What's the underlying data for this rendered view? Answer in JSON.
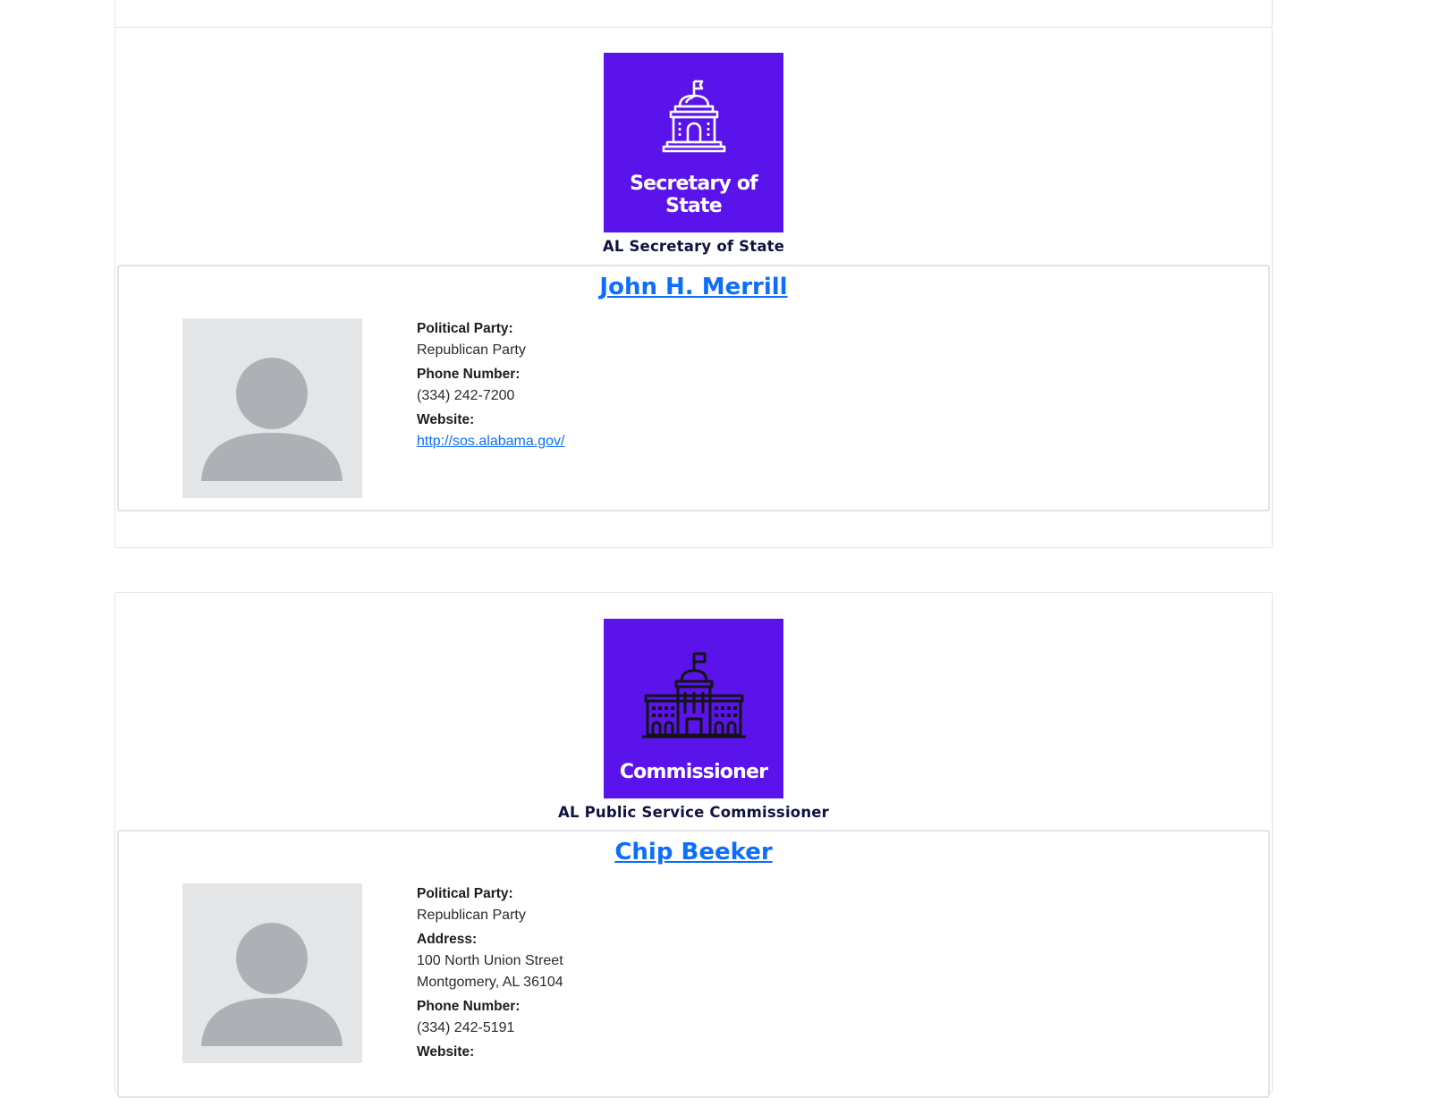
{
  "offices": [
    {
      "tile_title": "Secretary of State",
      "icon": "capitol-dome-outline-icon",
      "office_name": "AL Secretary of State",
      "candidate": {
        "name": "John H. Merrill",
        "fields": [
          {
            "label": "Political Party:",
            "value": "Republican Party"
          },
          {
            "label": "Phone Number:",
            "value": "(334) 242-7200"
          },
          {
            "label": "Website:",
            "value": "http://sos.alabama.gov/",
            "link": true
          }
        ]
      }
    },
    {
      "tile_title": "Commissioner",
      "icon": "capitol-building-icon",
      "office_name": "AL Public Service Commissioner",
      "candidate": {
        "name": "Chip Beeker",
        "fields": [
          {
            "label": "Political Party:",
            "value": "Republican Party"
          },
          {
            "label": "Address:",
            "value": "100 North Union Street",
            "value2": "Montgomery, AL 36104"
          },
          {
            "label": "Phone Number:",
            "value": "(334) 242-5191"
          },
          {
            "label": "Website:",
            "value": ""
          }
        ]
      }
    }
  ],
  "colors": {
    "tile_bg": "#5a14eb",
    "link": "#0d6efd",
    "office_name": "#10123f",
    "avatar_bg": "#e4e5e7",
    "avatar_fg": "#adb1b5"
  }
}
